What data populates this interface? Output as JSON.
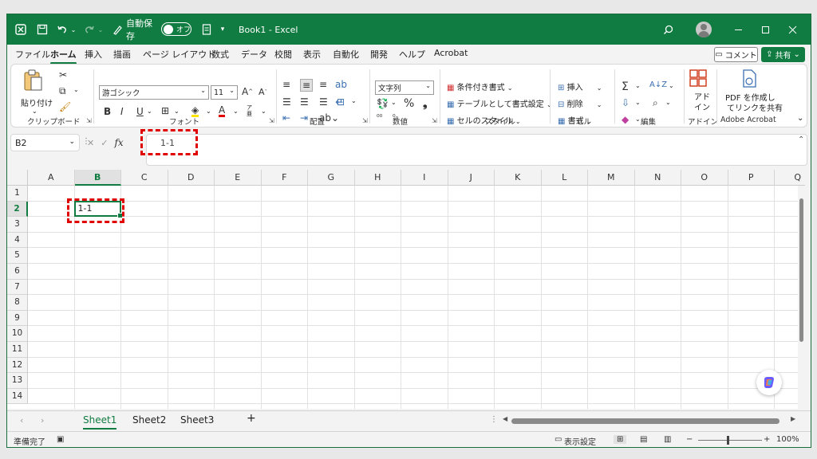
{
  "titlebar": {
    "autosave_label": "自動保存",
    "autosave_state": "オフ",
    "document_title": "Book1 - Excel",
    "color": "#107c41"
  },
  "menu": {
    "tabs": [
      "ファイル",
      "ホーム",
      "挿入",
      "描画",
      "ページ レイアウト",
      "数式",
      "データ",
      "校閲",
      "表示",
      "自動化",
      "開発",
      "ヘルプ",
      "Acrobat"
    ],
    "active_tab": "ホーム",
    "comment_label": "コメント",
    "share_label": "共有"
  },
  "ribbon": {
    "clipboard": {
      "paste_label": "貼り付け",
      "group_label": "クリップボード"
    },
    "font": {
      "font_name": "游ゴシック",
      "font_size": "11",
      "group_label": "フォント"
    },
    "alignment": {
      "group_label": "配置"
    },
    "number": {
      "format": "文字列",
      "group_label": "数値"
    },
    "styles": {
      "conditional_label": "条件付き書式",
      "table_label": "テーブルとして書式設定",
      "cell_style_label": "セルのスタイル",
      "group_label": "スタイル"
    },
    "cells": {
      "insert_label": "挿入",
      "delete_label": "削除",
      "format_label": "書式",
      "group_label": "セル"
    },
    "editing": {
      "group_label": "編集"
    },
    "addins": {
      "label_line1": "アド",
      "label_line2": "イン",
      "group_label": "アドイン"
    },
    "acrobat": {
      "label_line1": "PDF を作成し",
      "label_line2": "てリンクを共有",
      "group_label": "Adobe Acrobat"
    }
  },
  "formula_bar": {
    "name_box": "B2",
    "fx_label": "fx",
    "content": "1-1"
  },
  "grid": {
    "columns": [
      "A",
      "B",
      "C",
      "D",
      "E",
      "F",
      "G",
      "H",
      "I",
      "J",
      "K",
      "L",
      "M",
      "N",
      "O",
      "P",
      "Q"
    ],
    "rows": [
      "1",
      "2",
      "3",
      "4",
      "5",
      "6",
      "7",
      "8",
      "9",
      "10",
      "11",
      "12",
      "13",
      "14"
    ],
    "selected_column": "B",
    "selected_row": "2",
    "active_cell_value": "1-1"
  },
  "sheets": {
    "tabs": [
      "Sheet1",
      "Sheet2",
      "Sheet3"
    ],
    "active": "Sheet1",
    "add_label": "+"
  },
  "status": {
    "ready": "準備完了",
    "display_settings": "表示設定",
    "zoom": "100%",
    "zoom_level": 1.0
  },
  "annotation_color": "#e00000"
}
